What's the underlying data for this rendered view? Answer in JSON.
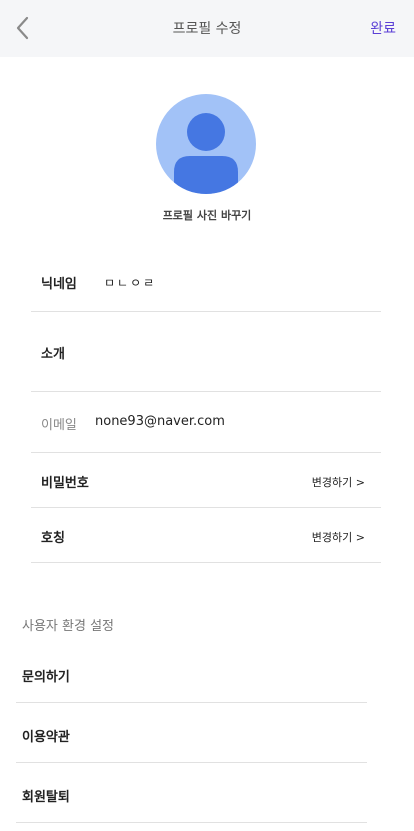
{
  "header": {
    "title": "프로필 수정",
    "done_label": "완료",
    "back_icon": "chevron-left-icon",
    "accent_color": "#5b3fd6",
    "background": "#f5f6f8"
  },
  "profile": {
    "avatar_icon": "user-avatar-icon",
    "avatar_bg": "#a2c2f7",
    "avatar_fg": "#4577e2",
    "change_photo_label": "프로필 사진 바꾸기"
  },
  "fields": {
    "nickname": {
      "label": "닉네임",
      "value": "ㅁㄴㅇㄹ"
    },
    "intro": {
      "label": "소개",
      "value": ""
    },
    "email": {
      "label": "이메일",
      "value": "none93@naver.com"
    },
    "password": {
      "label": "비밀번호",
      "action": "변경하기 >"
    },
    "title": {
      "label": "호칭",
      "action": "변경하기 >"
    }
  },
  "settings": {
    "section_title": "사용자 환경 설정",
    "items": [
      {
        "label": "문의하기"
      },
      {
        "label": "이용약관"
      },
      {
        "label": "회원탈퇴"
      }
    ]
  }
}
